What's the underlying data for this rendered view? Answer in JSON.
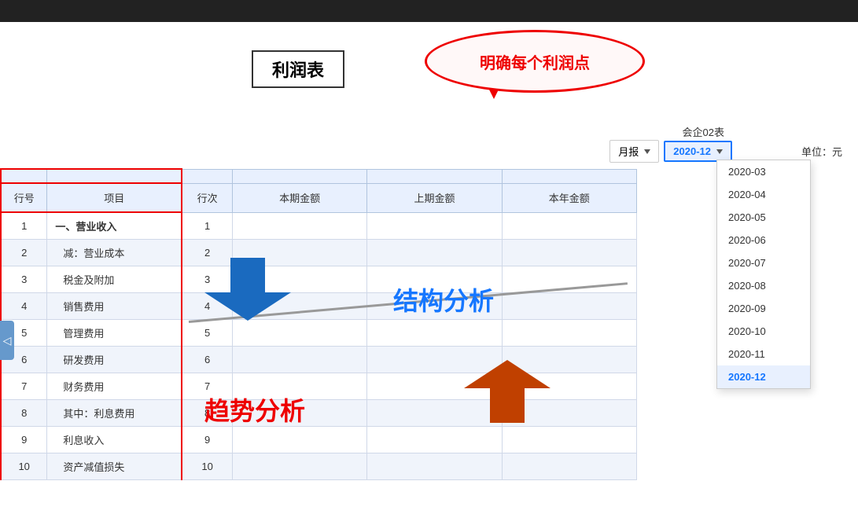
{
  "topbar": {},
  "callout": {
    "text": "明确每个利润点"
  },
  "title": {
    "text": "利润表"
  },
  "company": {
    "label": "会企02表"
  },
  "period_selector": {
    "label": "月报",
    "selected": "2020-12"
  },
  "unit": {
    "label": "单位：元"
  },
  "dropdown": {
    "options": [
      {
        "value": "2020-03",
        "label": "2020-03"
      },
      {
        "value": "2020-04",
        "label": "2020-04"
      },
      {
        "value": "2020-05",
        "label": "2020-05"
      },
      {
        "value": "2020-06",
        "label": "2020-06"
      },
      {
        "value": "2020-07",
        "label": "2020-07"
      },
      {
        "value": "2020-08",
        "label": "2020-08"
      },
      {
        "value": "2020-09",
        "label": "2020-09"
      },
      {
        "value": "2020-10",
        "label": "2020-10"
      },
      {
        "value": "2020-11",
        "label": "2020-11"
      },
      {
        "value": "2020-12",
        "label": "2020-12",
        "active": true
      }
    ]
  },
  "table": {
    "headers": [
      "行号",
      "项目",
      "行次",
      "本期金额",
      "上期金额",
      "本年金额"
    ],
    "rows": [
      {
        "row_no": "1",
        "item": "一、营业收入",
        "bold": true,
        "line": "1",
        "current": "",
        "prev": "",
        "ytd": ""
      },
      {
        "row_no": "2",
        "item": "减：营业成本",
        "bold": false,
        "line": "2",
        "current": "",
        "prev": "",
        "ytd": ""
      },
      {
        "row_no": "3",
        "item": "税金及附加",
        "bold": false,
        "line": "3",
        "current": "",
        "prev": "",
        "ytd": ""
      },
      {
        "row_no": "4",
        "item": "销售费用",
        "bold": false,
        "line": "4",
        "current": "",
        "prev": "",
        "ytd": ""
      },
      {
        "row_no": "5",
        "item": "管理费用",
        "bold": false,
        "line": "5",
        "current": "",
        "prev": "",
        "ytd": ""
      },
      {
        "row_no": "6",
        "item": "研发费用",
        "bold": false,
        "line": "6",
        "current": "",
        "prev": "",
        "ytd": ""
      },
      {
        "row_no": "7",
        "item": "财务费用",
        "bold": false,
        "line": "7",
        "current": "",
        "prev": "",
        "ytd": ""
      },
      {
        "row_no": "8",
        "item": "其中：利息费用",
        "bold": false,
        "line": "8",
        "current": "",
        "prev": "",
        "ytd": ""
      },
      {
        "row_no": "9",
        "item": "利息收入",
        "bold": false,
        "line": "9",
        "current": "",
        "prev": "",
        "ytd": ""
      },
      {
        "row_no": "10",
        "item": "资产减值损失",
        "bold": false,
        "line": "10",
        "current": "",
        "prev": "",
        "ytd": ""
      }
    ]
  },
  "overlays": {
    "structure_label": "结构分析",
    "trend_label": "趋势分析"
  },
  "toggle_btn": "◁"
}
